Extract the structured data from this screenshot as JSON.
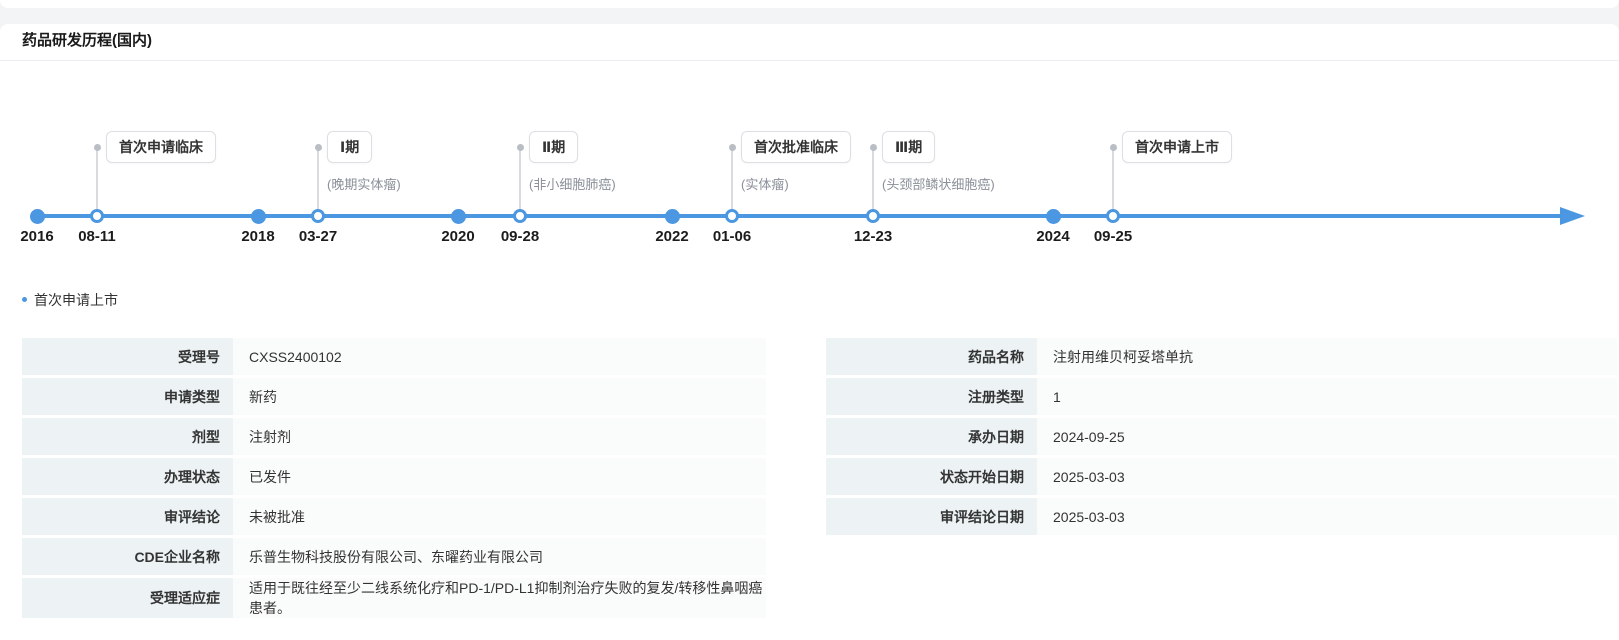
{
  "colors": {
    "accent": "#4b97e1",
    "label_cell_bg": "#edf3f5",
    "value_cell_bg": "#fafbfb"
  },
  "card": {
    "title": "药品研发历程(国内)"
  },
  "timeline": {
    "years": [
      {
        "label": "2016"
      },
      {
        "label": "2018"
      },
      {
        "label": "2020"
      },
      {
        "label": "2022"
      },
      {
        "label": "2024"
      }
    ],
    "events": [
      {
        "date": "08-11",
        "label": "首次申请临床",
        "indication": ""
      },
      {
        "date": "03-27",
        "label": "Ⅰ期",
        "indication": "(晚期实体瘤)"
      },
      {
        "date": "09-28",
        "label": "Ⅱ期",
        "indication": "(非小细胞肺癌)"
      },
      {
        "date": "01-06",
        "label": "首次批准临床",
        "indication": "(实体瘤)"
      },
      {
        "date": "12-23",
        "label": "Ⅲ期",
        "indication": "(头颈部鳞状细胞癌)"
      },
      {
        "date": "09-25",
        "label": "首次申请上市",
        "indication": ""
      }
    ]
  },
  "detail": {
    "section_title": "首次申请上市",
    "left_rows": [
      {
        "label": "受理号",
        "value": "CXSS2400102"
      },
      {
        "label": "申请类型",
        "value": "新药"
      },
      {
        "label": "剂型",
        "value": "注射剂"
      },
      {
        "label": "办理状态",
        "value": "已发件"
      },
      {
        "label": "审评结论",
        "value": "未被批准"
      },
      {
        "label": "CDE企业名称",
        "value": "乐普生物科技股份有限公司、东曜药业有限公司"
      },
      {
        "label": "受理适应症",
        "value": "适用于既往经至少二线系统化疗和PD-1/PD-L1抑制剂治疗失败的复发/转移性鼻咽癌患者。"
      }
    ],
    "right_rows": [
      {
        "label": "药品名称",
        "value": "注射用维贝柯妥塔单抗"
      },
      {
        "label": "注册类型",
        "value": "1"
      },
      {
        "label": "承办日期",
        "value": "2024-09-25"
      },
      {
        "label": "状态开始日期",
        "value": "2025-03-03"
      },
      {
        "label": "审评结论日期",
        "value": "2025-03-03"
      }
    ]
  }
}
